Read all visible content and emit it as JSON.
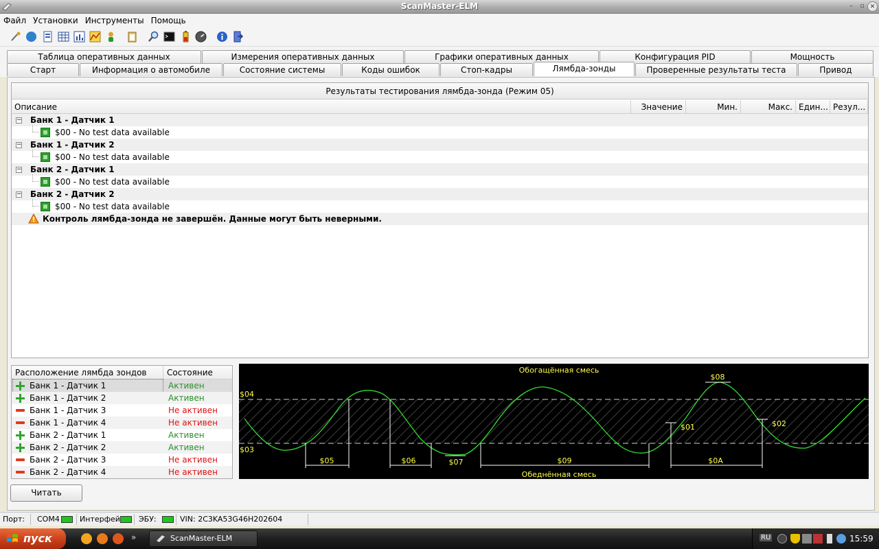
{
  "window": {
    "title": "ScanMaster-ELM"
  },
  "menu": [
    "Файл",
    "Установки",
    "Инструменты",
    "Помощь"
  ],
  "tabs_row1": [
    "Таблица оперативных данных",
    "Измерения оперативных данных",
    "Графики оперативных данных",
    "Конфигурация PID",
    "Мощность"
  ],
  "tabs_row2": [
    "Старт",
    "Информация о автомобиле",
    "Состояние системы",
    "Коды ошибок",
    "Стоп-кадры",
    "Лямбда-зонды",
    "Проверенные результаты теста",
    "Привод"
  ],
  "active_tab": "Лямбда-зонды",
  "results": {
    "title": "Результаты тестирования лямбда-зонда (Режим 05)",
    "columns": [
      "Описание",
      "Значение",
      "Мин.",
      "Макс.",
      "Един...",
      "Резул..."
    ],
    "groups": [
      {
        "name": "Банк 1 - Датчик 1",
        "item": "$00 - No test data available"
      },
      {
        "name": "Банк 1 - Датчик 2",
        "item": "$00 - No test data available"
      },
      {
        "name": "Банк 2 - Датчик 1",
        "item": "$00 - No test data available"
      },
      {
        "name": "Банк 2 - Датчик 2",
        "item": "$00 - No test data available"
      }
    ],
    "warning": "Контроль лямбда-зонда не завершён. Данные могут быть неверными."
  },
  "sensors": {
    "columns": [
      "Расположение лямбда зондов",
      "Состояние"
    ],
    "rows": [
      {
        "name": "Банк 1 - Датчик 1",
        "status": "Активен",
        "active": true
      },
      {
        "name": "Банк 1 - Датчик 2",
        "status": "Активен",
        "active": true
      },
      {
        "name": "Банк 1 - Датчик 3",
        "status": "Не активен",
        "active": false
      },
      {
        "name": "Банк 1 - Датчик 4",
        "status": "Не активен",
        "active": false
      },
      {
        "name": "Банк 2 - Датчик 1",
        "status": "Активен",
        "active": true
      },
      {
        "name": "Банк 2 - Датчик 2",
        "status": "Активен",
        "active": true
      },
      {
        "name": "Банк 2 - Датчик 3",
        "status": "Не активен",
        "active": false
      },
      {
        "name": "Банк 2 - Датчик 4",
        "status": "Не активен",
        "active": false
      }
    ]
  },
  "graph": {
    "rich_label": "Обогащённая смесь",
    "lean_label": "Обеднённая смесь",
    "labels": [
      "$04",
      "$03",
      "$08",
      "$01",
      "$02",
      "$05",
      "$06",
      "$07",
      "$09",
      "$0A"
    ]
  },
  "read_button": "Читать",
  "status": {
    "port_label": "Порт:",
    "port": "COM4",
    "interface_label": "Интерфейс:",
    "ecu_label": "ЭБУ:",
    "vin": "VIN: 2C3KA53G46H202604"
  },
  "taskbar": {
    "start": "пуск",
    "app": "ScanMaster-ELM",
    "lang": "RU",
    "clock": "15:59"
  },
  "colors": {
    "active": "#2a8f2a",
    "inactive": "#e01010",
    "graph_text": "#ffff4a",
    "curve": "#33dd33"
  }
}
